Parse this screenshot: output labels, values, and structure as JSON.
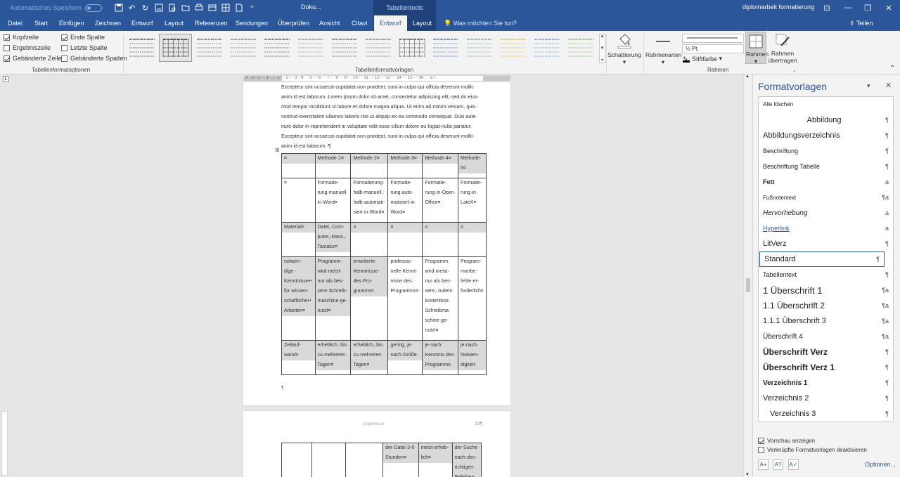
{
  "titlebar": {
    "autosave_label": "Automatisches Speichern",
    "doc_short": "Doku...",
    "context_group": "Tabellentools",
    "filename": "diplomarbeit formatierung"
  },
  "tabs": [
    "Datei",
    "Start",
    "Einfügen",
    "Zeichnen",
    "Entwurf",
    "Layout",
    "Referenzen",
    "Sendungen",
    "Überprüfen",
    "Ansicht",
    "Citavi",
    "Entwurf",
    "Layout"
  ],
  "active_tab_index": 11,
  "tell_me": "Was möchten Sie tun?",
  "share": "Teilen",
  "ribbon": {
    "options": {
      "kopfzeile": "Kopfzeile",
      "ergebniszeile": "Ergebniszeile",
      "gebaenderte_zeilen": "Gebänderte Zeilen",
      "erste_spalte": "Erste Spalte",
      "letzte_spalte": "Letzte Spalte",
      "gebaenderte_spalten": "Gebänderte Spalten",
      "group_label": "Tabellenformatoptionen"
    },
    "styles_group_label": "Tabellenformatvorlagen",
    "schattierung": "Schattierung",
    "rahmenarten": "Rahmenarten",
    "line_weight": "½ Pt.",
    "stiftfarbe": "Stiftfarbe",
    "rahmen": "Rahmen",
    "rahmen_uebertragen_1": "Rahmen",
    "rahmen_uebertragen_2": "übertragen",
    "borders_group_label": "Rahmen"
  },
  "ruler_labels": "3 · 2 · 1 · · 1 · · · 1 · · 2 · · 3 · 4 · · 5 · · 6 · · 7 · · 8 · · 9 · · 10 · · 11 · · 12 · · 13 · · 14 · · 15 · · 16 · · 17 ·",
  "document": {
    "paragraph_lines": [
      "Excepteur·sint·occaecat·cupidatat·non·proident,·sunt·in·culpa·qui·officia·deserunt·mollit·",
      "anim·id·est·laborum.·Lorem·ipsum·dolor·sit·amet,·consectetur·adipiscing·elit,·sed·do·eius-",
      "mod·tempor·incididunt·ut·labore·et·dolore·magna·aliqua.·Ut·enim·ad·minim·veniam,·quis·",
      "nostrud·exercitation·ullamco·laboris·nisi·ut·aliquip·ex·ea·commodo·consequat.·Duis·aute·",
      "irure·dolor·in·reprehenderit·in·voluptate·velit·esse·cillum·dolore·eu·fugiat·nulla·pariatur.·",
      "Excepteur·sint·occaecat·cupidatat·non·proident,·sunt·in·culpa·qui·officia·deserunt·mollit·",
      "anim·id·est·laborum.·¶"
    ],
    "table_rows": [
      [
        [
          "¤"
        ],
        [
          "Methode·1¤"
        ],
        [
          "Methode·2¤"
        ],
        [
          "Methode·3¤"
        ],
        [
          "Methode·4¤"
        ],
        [
          "Methode·",
          "5¤"
        ]
      ],
      [
        [
          "¤"
        ],
        [
          "Formatie-",
          "rung·manuell·",
          "in·Word¤"
        ],
        [
          "Formatierung·",
          "halb·manuell,·",
          "halb·automati-",
          "siert·in·Word¤"
        ],
        [
          "Formatie-",
          "rung·auto-",
          "matisiert·in·",
          "Word¤"
        ],
        [
          "Formatie-",
          "rung·in·Open·",
          "Office¤"
        ],
        [
          "Formatie-",
          "rung·in·",
          "LateX¤"
        ]
      ],
      [
        [
          "Material¤"
        ],
        [
          "Datei,·Com-",
          "puter,·Maus,·",
          "Tastatur¤"
        ],
        [
          "¤"
        ],
        [
          "¤"
        ],
        [
          "¤"
        ],
        [
          "¤"
        ]
      ],
      [
        [
          "notwen-",
          "dige·",
          "Kenntnisse↵",
          "für·wissen-",
          "schaftliche↵",
          "Arbeiten¤"
        ],
        [
          "Programm·",
          "wird·meist·",
          "nur·als·bes-",
          "sere·Schreib-",
          "maschine·ge-",
          "nutzt¤"
        ],
        [
          "erweiterte·",
          "Kenntnisse·",
          "des·Pro-",
          "gramms¤"
        ],
        [
          "professio-",
          "nelle·Kennt-",
          "nisse·des·",
          "Programms¤"
        ],
        [
          "Programm·",
          "wird·meist·",
          "nur·als·bes-",
          "sere,·zudem·",
          "kostenlose·",
          "Schreibma-",
          "schine·ge-",
          "nutzt¤"
        ],
        [
          "Program-",
          "mierbe-",
          "fehle·er-",
          "forderlich¤"
        ]
      ],
      [
        [
          "Zeitauf-",
          "wand¤"
        ],
        [
          "erheblich,·bis·",
          "zu·mehreren·",
          "Tagen¤"
        ],
        [
          "erheblich,·bis·",
          "zu·mehreren·",
          "Tagen¤"
        ],
        [
          "gering,·je·",
          "nach·Größe·"
        ],
        [
          "je·nach·",
          "Kenntnis·des·",
          "Programms·"
        ],
        [
          "je·nach·",
          "Notwen-",
          "digkeit·"
        ]
      ]
    ],
    "end_pilcrow": "¶",
    "footer_label": "Ergebnisse",
    "page_number": "10¶",
    "table2_rows": [
      [
        [
          ""
        ],
        [
          ""
        ],
        [
          ""
        ],
        [
          "der·Datei·3-6·",
          "Stunden¤"
        ],
        [
          "meist·erheb-",
          "lich¤"
        ],
        [
          "der·Suche·",
          "nach·den·",
          "richtigen·",
          "Befehlen·"
        ]
      ]
    ]
  },
  "pane": {
    "title": "Formatvorlagen",
    "clear_all": "Alle löschen",
    "styles": [
      {
        "name": "Abbildung",
        "mark": "¶"
      },
      {
        "name": "Abbildungsverzeichnis",
        "mark": "¶"
      },
      {
        "name": "Beschriftung",
        "mark": "¶"
      },
      {
        "name": "Beschriftung Tabelle",
        "mark": "¶"
      },
      {
        "name": "Fett",
        "mark": "a"
      },
      {
        "name": "Fußnotentext",
        "mark": "¶a"
      },
      {
        "name": "Hervorhebung",
        "mark": "a"
      },
      {
        "name": "Hyperlink",
        "mark": "a"
      },
      {
        "name": "LitVerz",
        "mark": "¶"
      },
      {
        "name": "Standard",
        "mark": "¶"
      },
      {
        "name": "Tabellentext",
        "mark": "¶"
      },
      {
        "name": "1  Überschrift 1",
        "mark": "¶a"
      },
      {
        "name": "1.1  Überschrift 2",
        "mark": "¶a"
      },
      {
        "name": "1.1.1  Überschrift 3",
        "mark": "¶a"
      },
      {
        "name": "Überschrift 4",
        "mark": "¶a"
      },
      {
        "name": "Überschrift Verz",
        "mark": "¶"
      },
      {
        "name": "Überschrift Verz 1",
        "mark": "¶"
      },
      {
        "name": "Verzeichnis 1",
        "mark": "¶"
      },
      {
        "name": "Verzeichnis 2",
        "mark": "¶"
      },
      {
        "name": "Verzeichnis 3",
        "mark": "¶"
      }
    ],
    "selected_style": "Standard",
    "vorschau": "Vorschau anzeigen",
    "verknuepfte": "Verknüpfte Formatvorlagen deaktivieren",
    "options": "Optionen..."
  },
  "colors": {
    "accent": "#2b579a",
    "context": "#1e4279"
  }
}
